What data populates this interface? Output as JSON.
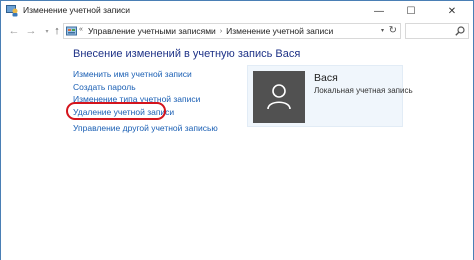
{
  "window": {
    "title": "Изменение учетной записи",
    "minimize": "—",
    "maximize": "☐",
    "close": "✕"
  },
  "nav": {
    "back": "←",
    "forward": "→",
    "recent": "▾",
    "up": "↑",
    "overflow": "«",
    "breadcrumbs": [
      "Управление учетными записями",
      "Изменение учетной записи"
    ],
    "separator": "›",
    "dropdown": "▾",
    "refresh": "↻"
  },
  "main": {
    "heading": "Внесение изменений в учетную запись Вася",
    "tasks": [
      "Изменить имя учетной записи",
      "Создать пароль",
      "Изменение типа учетной записи",
      "Удаление учетной записи",
      "Управление другой учетной записью"
    ],
    "highlighted_task": "Удаление учетной записи",
    "highlight_color": "#d4141c"
  },
  "account": {
    "name": "Вася",
    "type": "Локальная учетная запись",
    "avatar_icon": "user-silhouette-icon"
  }
}
